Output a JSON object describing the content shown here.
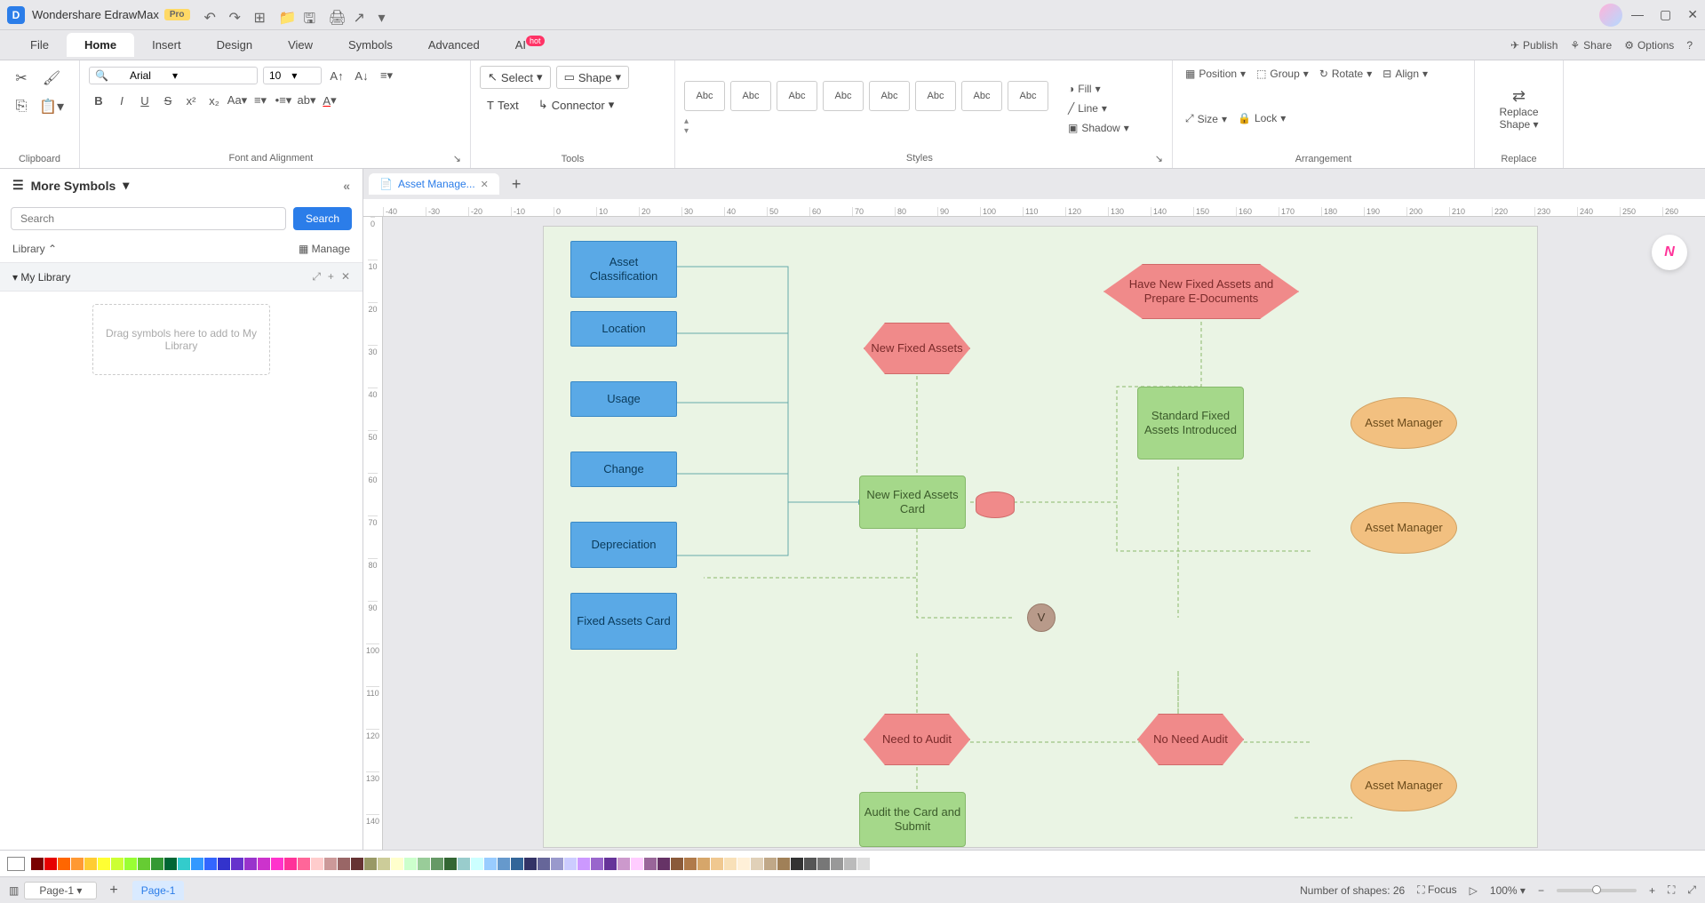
{
  "app": {
    "title": "Wondershare EdrawMax",
    "pro": "Pro"
  },
  "menu": {
    "file": "File",
    "home": "Home",
    "insert": "Insert",
    "design": "Design",
    "view": "View",
    "symbols": "Symbols",
    "advanced": "Advanced",
    "ai": "AI",
    "ai_badge": "hot",
    "publish": "Publish",
    "share": "Share",
    "options": "Options"
  },
  "ribbon": {
    "clipboard": "Clipboard",
    "font_alignment": "Font and Alignment",
    "font_name": "Arial",
    "font_size": "10",
    "tools": "Tools",
    "select": "Select",
    "shape": "Shape",
    "text": "Text",
    "connector": "Connector",
    "styles": "Styles",
    "abc": "Abc",
    "fill": "Fill",
    "line": "Line",
    "shadow": "Shadow",
    "arrangement": "Arrangement",
    "position": "Position",
    "group": "Group",
    "rotate": "Rotate",
    "align": "Align",
    "size_prop": "Size",
    "lock": "Lock",
    "replace": "Replace",
    "replace_shape": "Replace Shape"
  },
  "side": {
    "more_symbols": "More Symbols",
    "search_placeholder": "Search",
    "search_btn": "Search",
    "library": "Library",
    "manage": "Manage",
    "my_library": "My Library",
    "drop_hint": "Drag symbols here to add to My Library"
  },
  "tab": {
    "name": "Asset Manage...",
    "add": "+"
  },
  "shapes": {
    "s1": "Asset Classification",
    "s2": "Location",
    "s3": "Usage",
    "s4": "Change",
    "s5": "Depreciation",
    "s6": "Fixed Assets Card",
    "h1": "New Fixed Assets",
    "g1": "New Fixed Assets Card",
    "h2": "Have New Fixed Assets and Prepare E-Documents",
    "g2": "Standard Fixed Assets Introduced",
    "o1": "Asset Manager",
    "o2": "Asset Manager",
    "o3": "Asset Manager",
    "c1": "V",
    "h3": "Need to Audit",
    "h4": "No Need Audit",
    "g3": "Audit the Card and Submit"
  },
  "colorbar": [
    "#7a0000",
    "#e60000",
    "#ff6600",
    "#ff9933",
    "#ffcc33",
    "#ffff33",
    "#ccff33",
    "#99ff33",
    "#66cc33",
    "#339933",
    "#006633",
    "#33cccc",
    "#3399ff",
    "#3366ff",
    "#3333cc",
    "#6633cc",
    "#9933cc",
    "#cc33cc",
    "#ff33cc",
    "#ff3399",
    "#ff6699",
    "#ffcccc",
    "#cc9999",
    "#996666",
    "#663333",
    "#999966",
    "#cccc99",
    "#ffffcc",
    "#ccffcc",
    "#99cc99",
    "#669966",
    "#336633",
    "#99cccc",
    "#ccffff",
    "#99ccff",
    "#6699cc",
    "#336699",
    "#333366",
    "#666699",
    "#9999cc",
    "#ccccff",
    "#cc99ff",
    "#9966cc",
    "#663399",
    "#cc99cc",
    "#ffccff",
    "#996699",
    "#663366",
    "#8a5a3a",
    "#b07a4a",
    "#d6a66a",
    "#f0c890",
    "#f8e0b8",
    "#fff0d8",
    "#e0d0b8",
    "#c0a888",
    "#a08058",
    "#333333",
    "#555555",
    "#777777",
    "#999999",
    "#bbbbbb",
    "#dddddd",
    "#ffffff"
  ],
  "status": {
    "page_dd": "Page-1",
    "page_tab": "Page-1",
    "shapes_count": "Number of shapes: 26",
    "focus": "Focus",
    "zoom": "100%"
  },
  "ruler_h": [
    "-40",
    "-30",
    "-20",
    "-10",
    "0",
    "10",
    "20",
    "30",
    "40",
    "50",
    "60",
    "70",
    "80",
    "90",
    "100",
    "110",
    "120",
    "130",
    "140",
    "150",
    "160",
    "170",
    "180",
    "190",
    "200",
    "210",
    "220",
    "230",
    "240",
    "250",
    "260"
  ],
  "ruler_v": [
    "0",
    "10",
    "20",
    "30",
    "40",
    "50",
    "60",
    "70",
    "80",
    "90",
    "100",
    "110",
    "120",
    "130",
    "140"
  ]
}
